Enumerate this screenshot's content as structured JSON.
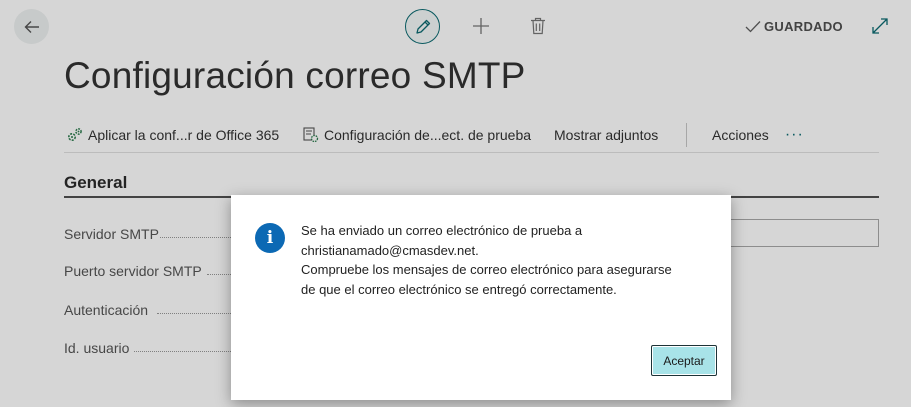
{
  "topbar": {
    "back_icon": "arrow-left-icon",
    "edit_icon": "pencil-icon",
    "new_icon": "plus-icon",
    "delete_icon": "trash-icon",
    "saved_label": "GUARDADO",
    "expand_icon": "expand-icon"
  },
  "page": {
    "title": "Configuración correo SMTP"
  },
  "actions": {
    "apply_office": "Aplicar la conf...r de Office 365",
    "test_config": "Configuración de...ect. de prueba",
    "show_attachments": "Mostrar adjuntos",
    "actions": "Acciones",
    "more": "···"
  },
  "section": {
    "title": "General",
    "fields": [
      {
        "label": "Servidor SMTP"
      },
      {
        "label": "Puerto servidor SMTP"
      },
      {
        "label": "Autenticación"
      },
      {
        "label": "Id. usuario"
      }
    ]
  },
  "dialog": {
    "icon": "info-icon",
    "icon_glyph": "i",
    "lines": [
      "Se ha enviado un correo electrónico de prueba a",
      "christianamado@cmasdev.net.",
      "Compruebe los mensajes de correo electrónico para asegurarse",
      "de que el correo electrónico se entregó correctamente."
    ],
    "ok_label": "Aceptar"
  },
  "colors": {
    "accent": "#0c6b72",
    "info": "#0c69b4",
    "ok_button": "#a8e3e8"
  }
}
